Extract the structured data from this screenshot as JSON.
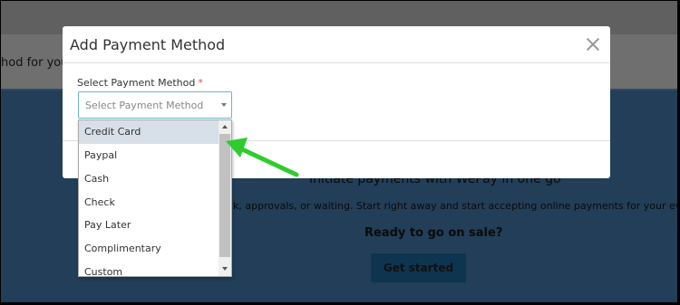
{
  "background": {
    "bar_text": "hod for your",
    "heading": "Initiate payments with WePay in one go",
    "subtext": "k, approvals, or waiting. Start right away and start accepting online payments for your events.",
    "ready_text": "Ready to go on sale?",
    "get_started_label": "Get started"
  },
  "modal": {
    "title": "Add Payment Method",
    "close_icon": "close-icon",
    "field_label": "Select Payment Method",
    "required_mark": "*",
    "select": {
      "placeholder": "Select Payment Method",
      "options": [
        "Credit Card",
        "Paypal",
        "Cash",
        "Check",
        "Pay Later",
        "Complimentary",
        "Custom"
      ],
      "highlighted_option": "Credit Card"
    }
  },
  "annotation": {
    "arrow_color": "#2ecc2e",
    "arrow_icon": "green-arrow-icon"
  },
  "colors": {
    "modal_bg": "#ffffff",
    "overlay": "#6e6e6e",
    "select_border": "#6cb4c9",
    "highlight": "#d7dfe8",
    "required": "#d9534f"
  }
}
